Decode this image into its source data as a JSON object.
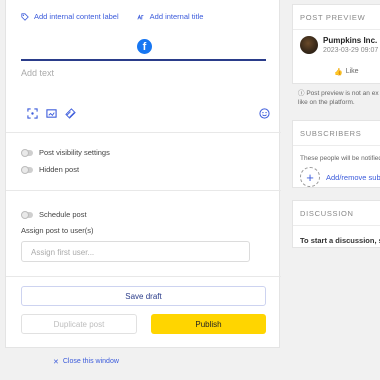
{
  "editor": {
    "add_label_link": "Add internal content label",
    "add_title_link": "Add internal title",
    "network_icon": "facebook-icon",
    "text_placeholder": "Add text",
    "post_visibility_label": "Post visibility settings",
    "hidden_post_label": "Hidden post",
    "schedule_post_label": "Schedule post",
    "assign_label": "Assign post to user(s)",
    "assign_placeholder": "Assign first user...",
    "save_draft": "Save draft",
    "duplicate_post": "Duplicate post",
    "publish": "Publish",
    "close_window": "Close this window"
  },
  "preview": {
    "title": "POST PREVIEW",
    "page_name": "Pumpkins Inc.",
    "date": "2023-03-29 09:07",
    "like_label": "Like",
    "note_line1": "Post preview is not an ex",
    "note_line2": "like on the platform."
  },
  "subscribers": {
    "title": "SUBSCRIBERS",
    "description": "These people will be notified",
    "add_remove": "Add/remove subsc"
  },
  "discussion": {
    "title": "DISCUSSION",
    "text": "To start a discussion, sa"
  },
  "colors": {
    "accent": "#3b5bdb",
    "publish": "#ffd500",
    "facebook": "#1877f2"
  }
}
